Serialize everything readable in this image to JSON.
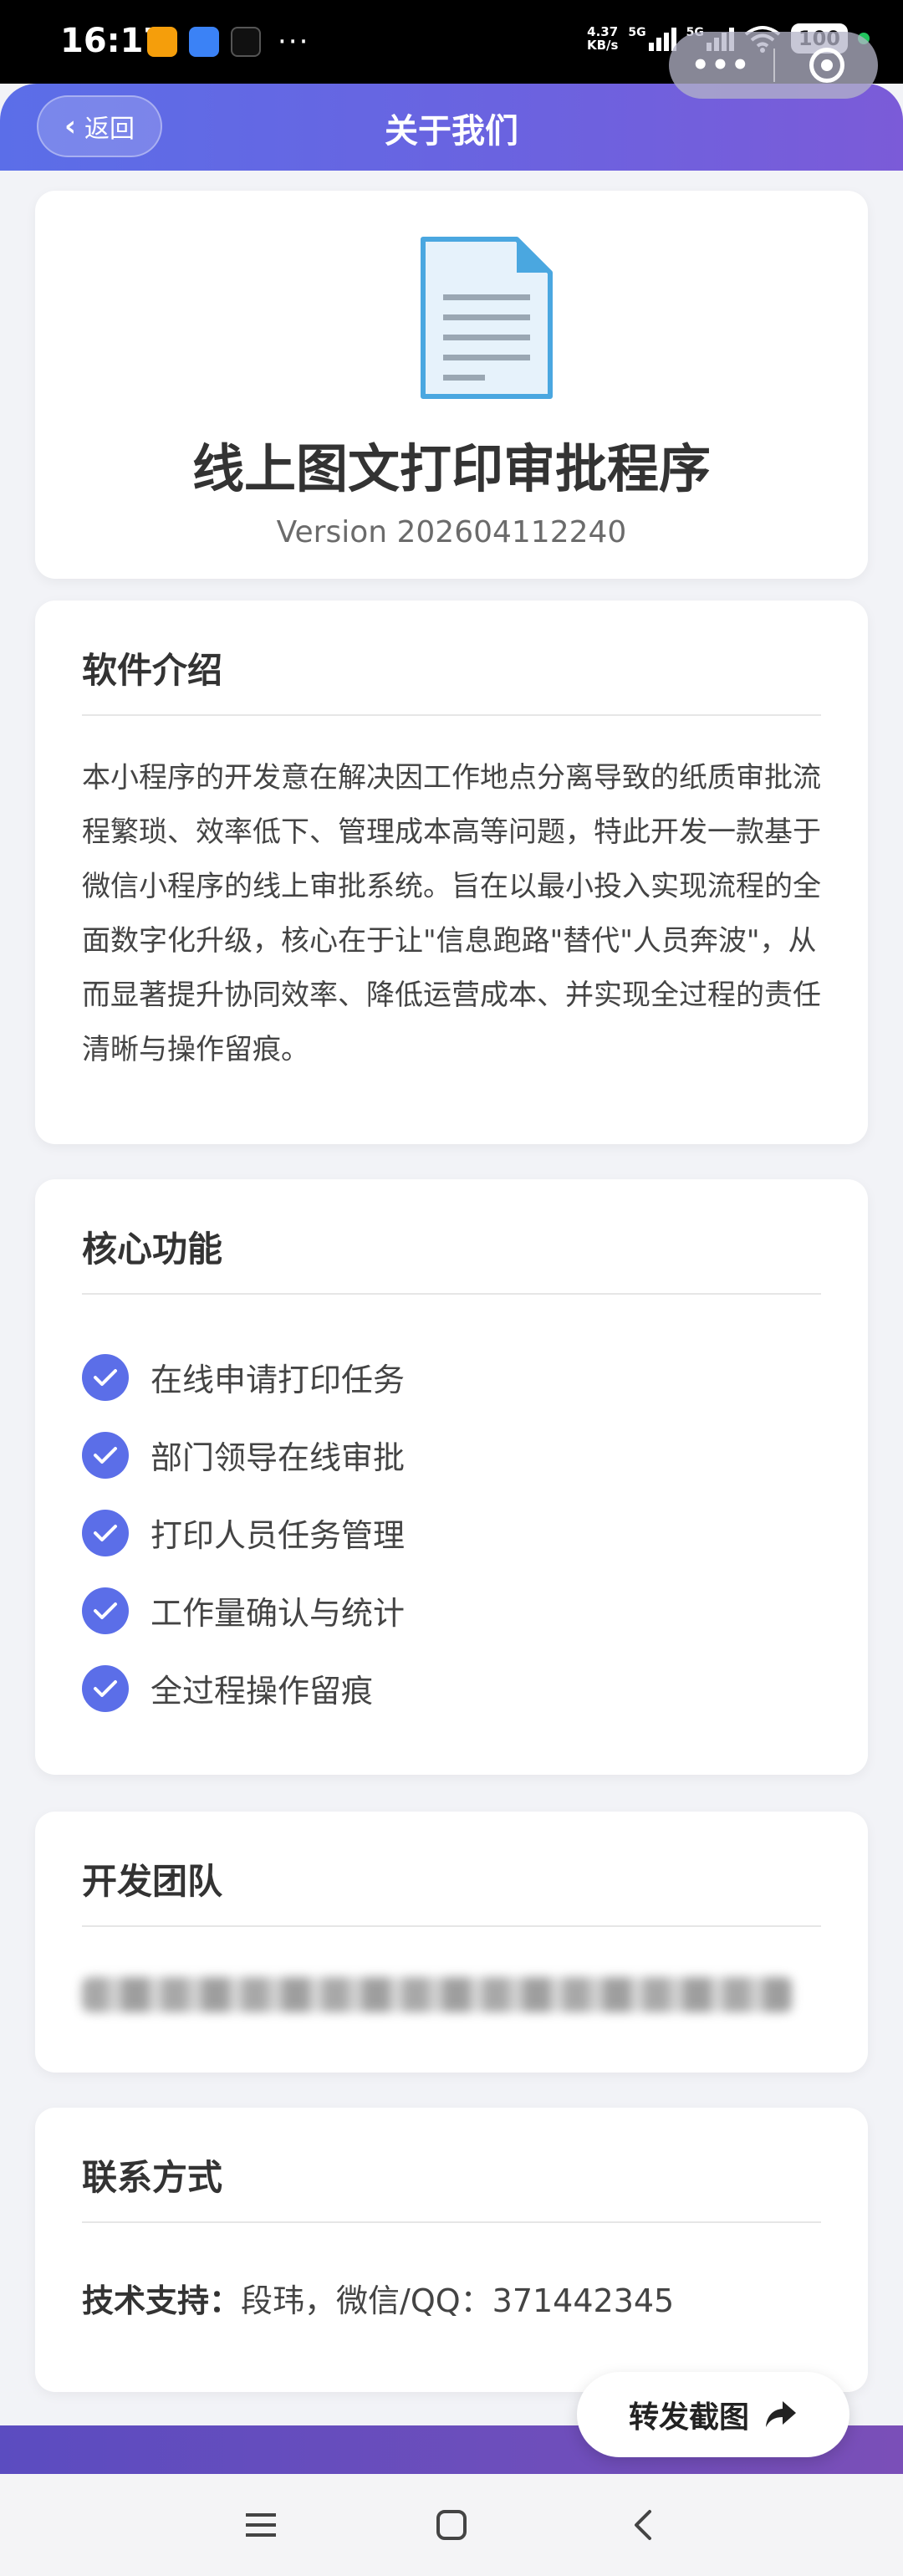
{
  "status_bar": {
    "time": "16:17",
    "more": "···",
    "speed_value": "4.37",
    "speed_unit": "KB/s",
    "signal1": "5G",
    "signal2": "5G",
    "battery": "100",
    "colors": {
      "app1": "#f59e0b",
      "app2": "#3b82f6",
      "app3": "#111111",
      "online_dot": "#22c55e"
    },
    "icons": [
      "app-notification-icon",
      "app-notification-icon",
      "tiktok-icon",
      "wifi-icon",
      "battery-icon"
    ]
  },
  "nav": {
    "back_label": "返回",
    "title": "关于我们",
    "capsule_more": "•••"
  },
  "hero": {
    "icon": "document-icon",
    "title": "线上图文打印审批程序",
    "version": "Version 202604112240"
  },
  "intro": {
    "heading": "软件介绍",
    "body": "本小程序的开发意在解决因工作地点分离导致的纸质审批流程繁琐、效率低下、管理成本高等问题，特此开发一款基于微信小程序的线上审批系统。旨在以最小投入实现流程的全面数字化升级，核心在于让\"信息跑路\"替代\"人员奔波\"，从而显著提升协同效率、降低运营成本、并实现全过程的责任清晰与操作留痕。"
  },
  "features": {
    "heading": "核心功能",
    "items": [
      "在线申请打印任务",
      "部门领导在线审批",
      "打印人员任务管理",
      "工作量确认与统计",
      "全过程操作留痕"
    ]
  },
  "team": {
    "heading": "开发团队"
  },
  "contact": {
    "heading": "联系方式",
    "label": "技术支持：",
    "value": "段玮，微信/QQ：371442345"
  },
  "share": {
    "label": "转发截图",
    "icon": "share-arrow-icon"
  },
  "system_nav": {
    "icons": [
      "menu-icon",
      "home-icon",
      "back-icon"
    ]
  },
  "theme": {
    "accent": "#5b6ee8",
    "nav_gradient_end": "#7b5bd8"
  }
}
